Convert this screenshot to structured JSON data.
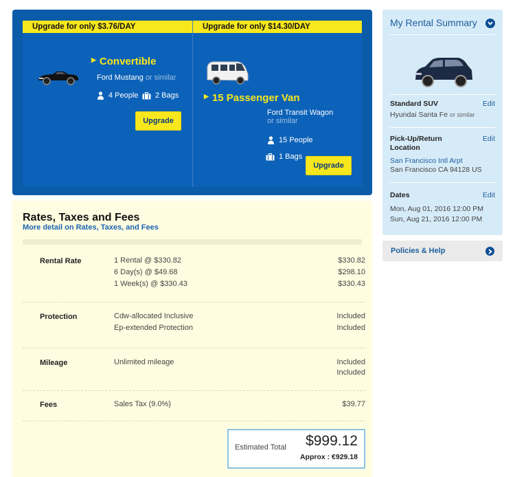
{
  "upgrades": [
    {
      "banner": "Upgrade for only $3.76/DAY",
      "category": "Convertible",
      "model": "Ford Mustang",
      "similar": "or similar",
      "people": "4 People",
      "bags": "2 Bags",
      "button": "Upgrade",
      "icons": [
        "person-icon",
        "luggage-icon"
      ]
    },
    {
      "banner": "Upgrade for only $14.30/DAY",
      "category": "15 Passenger Van",
      "model": "Ford Transit Wagon",
      "similar": "or similar",
      "people": "15 People",
      "bags": "1 Bags",
      "button": "Upgrade",
      "icons": [
        "person-icon",
        "luggage-icon"
      ]
    }
  ],
  "rates": {
    "title": "Rates, Taxes and Fees",
    "detail_link": "More detail on Rates, Taxes, and Fees",
    "sections": [
      {
        "heading": "Rental Rate",
        "lines": [
          {
            "desc": "1 Rental @ $330.82",
            "amount": "$330.82"
          },
          {
            "desc": "6 Day(s) @ $49.68",
            "amount": "$298.10"
          },
          {
            "desc": "1 Week(s) @ $330.43",
            "amount": "$330.43"
          }
        ]
      },
      {
        "heading": "Protection",
        "lines": [
          {
            "desc": "Cdw-allocated Inclusive",
            "amount": "Included"
          },
          {
            "desc": "Ep-extended Protection",
            "amount": "Included"
          }
        ]
      },
      {
        "heading": "Mileage",
        "lines": [
          {
            "desc": "Unlimited mileage",
            "amount": "Included"
          },
          {
            "desc": "",
            "amount": "Included"
          }
        ]
      },
      {
        "heading": "Fees",
        "lines": [
          {
            "desc": "Sales Tax (9.0%)",
            "amount": "$39.77"
          }
        ]
      }
    ],
    "total": {
      "label": "Estimated Total",
      "value": "$999.12",
      "approx": "Approx : €929.18"
    }
  },
  "summary": {
    "title": "My Rental Summary",
    "vehicle": {
      "heading": "Standard SUV",
      "model": "Hyundai Santa Fe",
      "similar": "or similar",
      "edit": "Edit"
    },
    "location": {
      "heading_line1": "Pick-Up/Return",
      "heading_line2": "Location",
      "name": "San Francisco Intl Arpt",
      "address": "San Francisco CA 94128 US",
      "edit": "Edit"
    },
    "dates": {
      "heading": "Dates",
      "pickup": "Mon, Aug 01, 2016 12:00 PM",
      "return": "Sun, Aug 21, 2016 12:00 PM",
      "edit": "Edit"
    }
  },
  "policies": {
    "label": "Policies & Help"
  },
  "colors": {
    "brand_blue": "#0a5ba8",
    "accent_yellow": "#f8e71c",
    "rates_bg": "#fffde1",
    "summary_bg": "#d6ebf8",
    "total_border": "#8cc3e3"
  }
}
